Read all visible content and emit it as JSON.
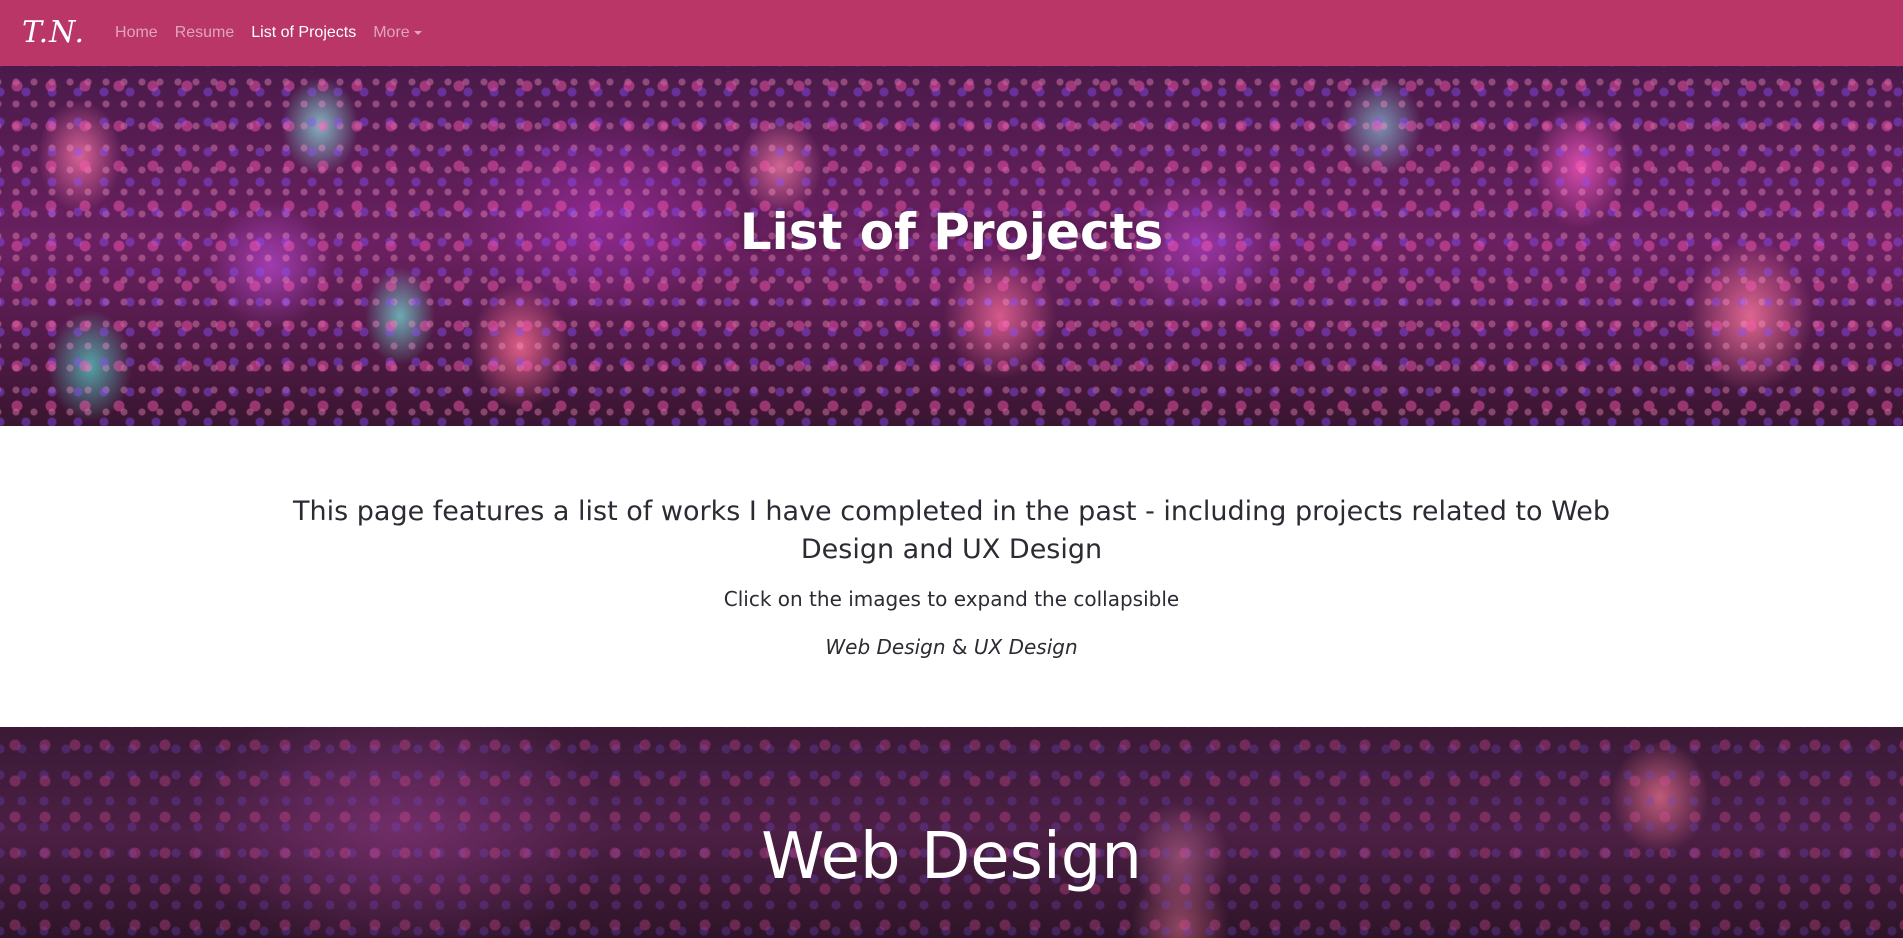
{
  "navbar": {
    "brand": "T.N.",
    "links": [
      {
        "label": "Home"
      },
      {
        "label": "Resume"
      },
      {
        "label": "List of Projects"
      },
      {
        "label": "More"
      }
    ],
    "bg_color": "#b93666"
  },
  "hero": {
    "title": "List of Projects"
  },
  "intro": {
    "lead": "This page features a list of works I have completed in the past - including projects related to Web Design and UX Design",
    "sub": "Click on the images to expand the collapsible",
    "link_web": "Web Design",
    "amp": "&",
    "link_ux": "UX Design"
  },
  "section": {
    "title": "Web Design"
  }
}
